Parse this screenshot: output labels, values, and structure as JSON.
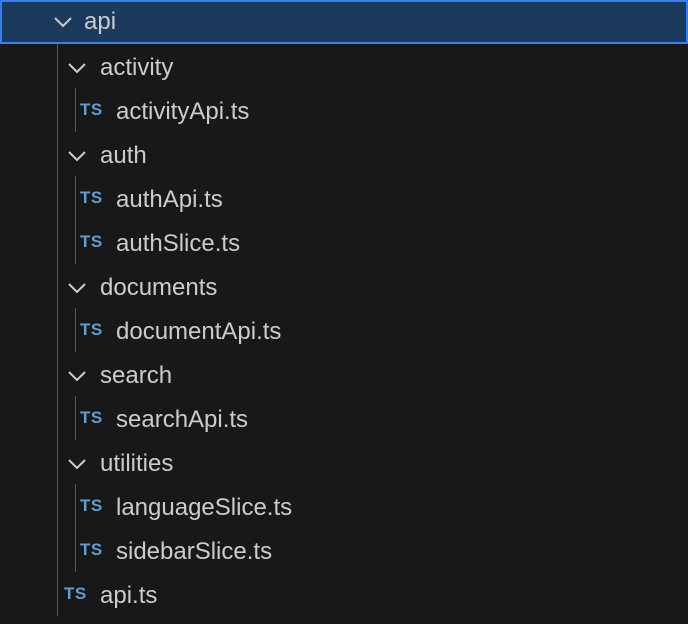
{
  "tree": {
    "root_folder": "api",
    "items": [
      {
        "kind": "folder",
        "label": "activity",
        "badge": ""
      },
      {
        "kind": "file",
        "label": "activityApi.ts",
        "badge": "TS"
      },
      {
        "kind": "folder",
        "label": "auth",
        "badge": ""
      },
      {
        "kind": "file",
        "label": "authApi.ts",
        "badge": "TS"
      },
      {
        "kind": "file",
        "label": "authSlice.ts",
        "badge": "TS"
      },
      {
        "kind": "folder",
        "label": "documents",
        "badge": ""
      },
      {
        "kind": "file",
        "label": "documentApi.ts",
        "badge": "TS"
      },
      {
        "kind": "folder",
        "label": "search",
        "badge": ""
      },
      {
        "kind": "file",
        "label": "searchApi.ts",
        "badge": "TS"
      },
      {
        "kind": "folder",
        "label": "utilities",
        "badge": ""
      },
      {
        "kind": "file",
        "label": "languageSlice.ts",
        "badge": "TS"
      },
      {
        "kind": "file",
        "label": "sidebarSlice.ts",
        "badge": "TS"
      },
      {
        "kind": "file",
        "label": "api.ts",
        "badge": "TS"
      }
    ]
  },
  "colors": {
    "background": "#181818",
    "selected_bg": "#1b3a5c",
    "selected_border": "#2f81f7",
    "text": "#cccccc",
    "ts_badge": "#5b9fd6",
    "indent_guide": "#585858"
  }
}
